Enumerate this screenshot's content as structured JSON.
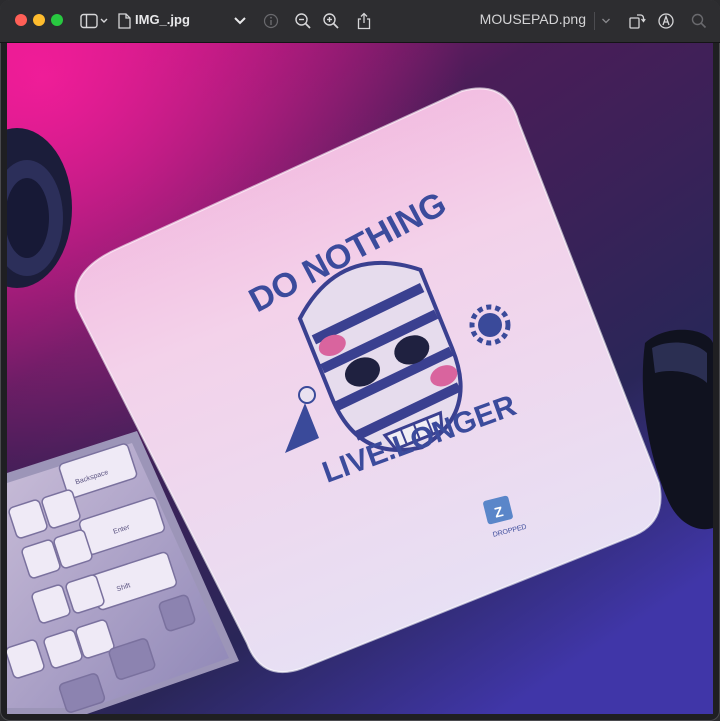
{
  "window": {
    "tab_title": "IMG_.jpg",
    "document_title": "MOUSEPAD.png"
  },
  "toolbar": {
    "icons": [
      "sidebar-icon",
      "chevron-down-icon",
      "document-icon",
      "chevron-down-icon",
      "info-icon",
      "zoom-out-icon",
      "zoom-in-icon",
      "share-icon",
      "rotate-icon",
      "markup-icon",
      "search-icon"
    ]
  },
  "image": {
    "pad_text_top": "DO NOTHING",
    "pad_text_bottom": "LIVE.LONGER",
    "badge_letter": "Z",
    "badge_text": "DROPPED",
    "keys": [
      "Backspace",
      "Enter",
      "Shift"
    ]
  }
}
